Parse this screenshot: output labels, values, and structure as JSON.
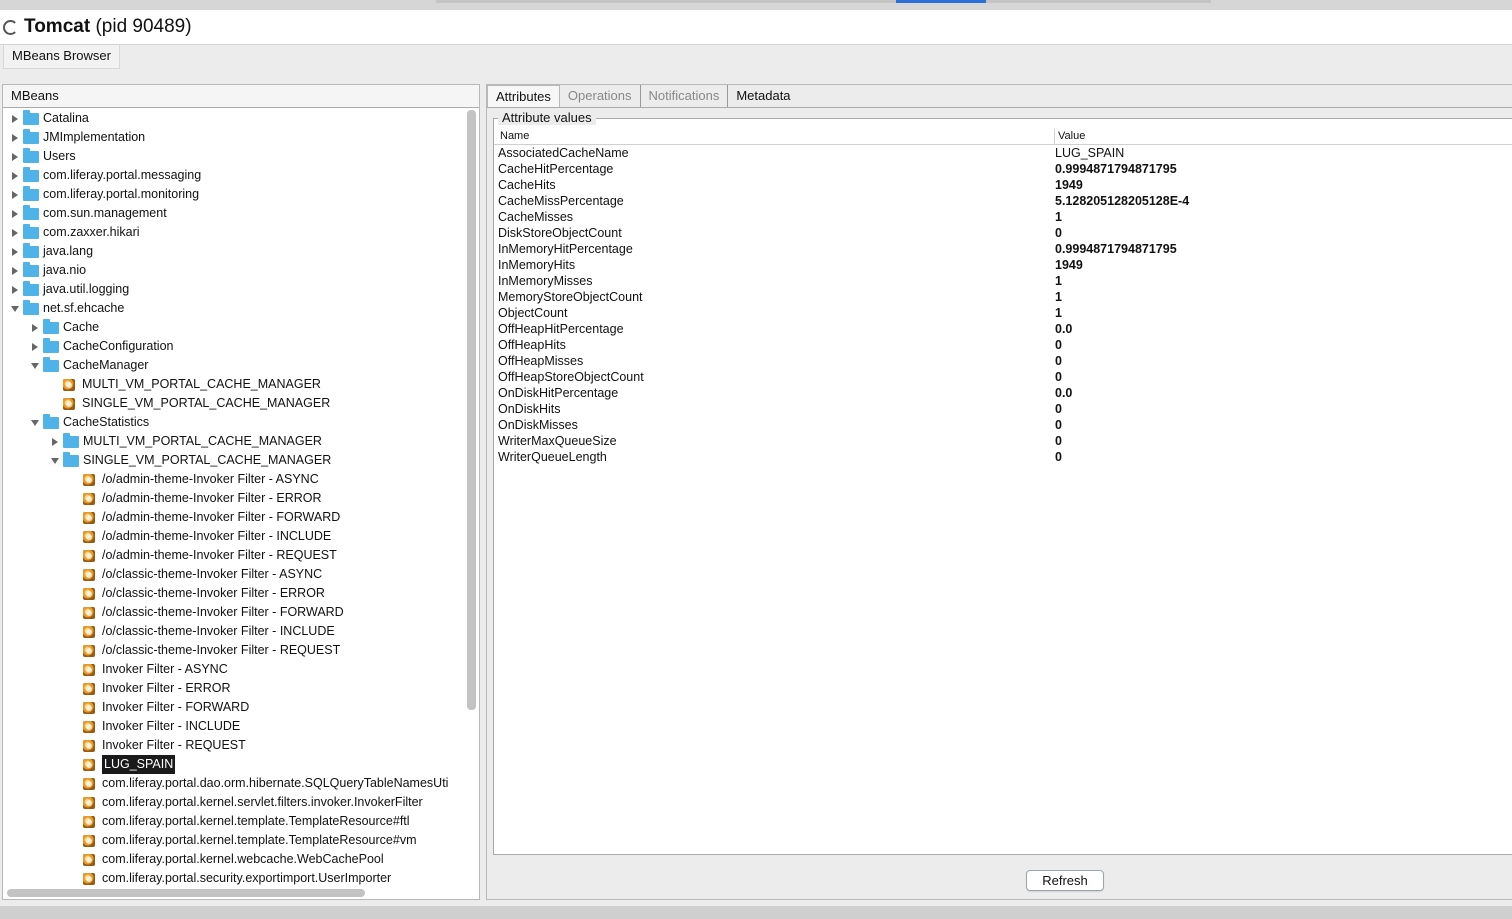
{
  "window": {
    "title_bold": "Tomcat",
    "title_rest": " (pid 90489)"
  },
  "subtab": "MBeans Browser",
  "left_panel": {
    "header": "MBeans"
  },
  "tree": [
    {
      "label": "Catalina",
      "type": "folder",
      "state": "collapsed",
      "depth": 0
    },
    {
      "label": "JMImplementation",
      "type": "folder",
      "state": "collapsed",
      "depth": 0
    },
    {
      "label": "Users",
      "type": "folder",
      "state": "collapsed",
      "depth": 0
    },
    {
      "label": "com.liferay.portal.messaging",
      "type": "folder",
      "state": "collapsed",
      "depth": 0
    },
    {
      "label": "com.liferay.portal.monitoring",
      "type": "folder",
      "state": "collapsed",
      "depth": 0
    },
    {
      "label": "com.sun.management",
      "type": "folder",
      "state": "collapsed",
      "depth": 0
    },
    {
      "label": "com.zaxxer.hikari",
      "type": "folder",
      "state": "collapsed",
      "depth": 0
    },
    {
      "label": "java.lang",
      "type": "folder",
      "state": "collapsed",
      "depth": 0
    },
    {
      "label": "java.nio",
      "type": "folder",
      "state": "collapsed",
      "depth": 0
    },
    {
      "label": "java.util.logging",
      "type": "folder",
      "state": "collapsed",
      "depth": 0
    },
    {
      "label": "net.sf.ehcache",
      "type": "folder",
      "state": "expanded",
      "depth": 0
    },
    {
      "label": "Cache",
      "type": "folder",
      "state": "collapsed",
      "depth": 1
    },
    {
      "label": "CacheConfiguration",
      "type": "folder",
      "state": "collapsed",
      "depth": 1
    },
    {
      "label": "CacheManager",
      "type": "folder",
      "state": "expanded",
      "depth": 1
    },
    {
      "label": "MULTI_VM_PORTAL_CACHE_MANAGER",
      "type": "bean",
      "state": "none",
      "depth": 2
    },
    {
      "label": "SINGLE_VM_PORTAL_CACHE_MANAGER",
      "type": "bean",
      "state": "none",
      "depth": 2
    },
    {
      "label": "CacheStatistics",
      "type": "folder",
      "state": "expanded",
      "depth": 1
    },
    {
      "label": "MULTI_VM_PORTAL_CACHE_MANAGER",
      "type": "folder",
      "state": "collapsed",
      "depth": 2
    },
    {
      "label": "SINGLE_VM_PORTAL_CACHE_MANAGER",
      "type": "folder",
      "state": "expanded",
      "depth": 2
    },
    {
      "label": "/o/admin-theme-Invoker Filter - ASYNC",
      "type": "bean",
      "state": "none",
      "depth": 3
    },
    {
      "label": "/o/admin-theme-Invoker Filter - ERROR",
      "type": "bean",
      "state": "none",
      "depth": 3
    },
    {
      "label": "/o/admin-theme-Invoker Filter - FORWARD",
      "type": "bean",
      "state": "none",
      "depth": 3
    },
    {
      "label": "/o/admin-theme-Invoker Filter - INCLUDE",
      "type": "bean",
      "state": "none",
      "depth": 3
    },
    {
      "label": "/o/admin-theme-Invoker Filter - REQUEST",
      "type": "bean",
      "state": "none",
      "depth": 3
    },
    {
      "label": "/o/classic-theme-Invoker Filter - ASYNC",
      "type": "bean",
      "state": "none",
      "depth": 3
    },
    {
      "label": "/o/classic-theme-Invoker Filter - ERROR",
      "type": "bean",
      "state": "none",
      "depth": 3
    },
    {
      "label": "/o/classic-theme-Invoker Filter - FORWARD",
      "type": "bean",
      "state": "none",
      "depth": 3
    },
    {
      "label": "/o/classic-theme-Invoker Filter - INCLUDE",
      "type": "bean",
      "state": "none",
      "depth": 3
    },
    {
      "label": "/o/classic-theme-Invoker Filter - REQUEST",
      "type": "bean",
      "state": "none",
      "depth": 3
    },
    {
      "label": "Invoker Filter - ASYNC",
      "type": "bean",
      "state": "none",
      "depth": 3
    },
    {
      "label": "Invoker Filter - ERROR",
      "type": "bean",
      "state": "none",
      "depth": 3
    },
    {
      "label": "Invoker Filter - FORWARD",
      "type": "bean",
      "state": "none",
      "depth": 3
    },
    {
      "label": "Invoker Filter - INCLUDE",
      "type": "bean",
      "state": "none",
      "depth": 3
    },
    {
      "label": "Invoker Filter - REQUEST",
      "type": "bean",
      "state": "none",
      "depth": 3
    },
    {
      "label": "LUG_SPAIN",
      "type": "bean",
      "state": "none",
      "depth": 3,
      "selected": true
    },
    {
      "label": "com.liferay.portal.dao.orm.hibernate.SQLQueryTableNamesUti",
      "type": "bean",
      "state": "none",
      "depth": 3
    },
    {
      "label": "com.liferay.portal.kernel.servlet.filters.invoker.InvokerFilter",
      "type": "bean",
      "state": "none",
      "depth": 3
    },
    {
      "label": "com.liferay.portal.kernel.template.TemplateResource#ftl",
      "type": "bean",
      "state": "none",
      "depth": 3
    },
    {
      "label": "com.liferay.portal.kernel.template.TemplateResource#vm",
      "type": "bean",
      "state": "none",
      "depth": 3
    },
    {
      "label": "com.liferay.portal.kernel.webcache.WebCachePool",
      "type": "bean",
      "state": "none",
      "depth": 3
    },
    {
      "label": "com.liferay.portal.security.exportimport.UserImporter",
      "type": "bean",
      "state": "none",
      "depth": 3
    }
  ],
  "tabs": [
    {
      "label": "Attributes",
      "style": "active"
    },
    {
      "label": "Operations",
      "style": "disabled"
    },
    {
      "label": "Notifications",
      "style": "disabled"
    },
    {
      "label": "Metadata",
      "style": "plain"
    }
  ],
  "attributes": {
    "title": "Attribute values",
    "col_name": "Name",
    "col_value": "Value",
    "rows": [
      {
        "name": "AssociatedCacheName",
        "value": "LUG_SPAIN",
        "bold": false
      },
      {
        "name": "CacheHitPercentage",
        "value": "0.9994871794871795",
        "bold": true
      },
      {
        "name": "CacheHits",
        "value": "1949",
        "bold": true
      },
      {
        "name": "CacheMissPercentage",
        "value": "5.128205128205128E-4",
        "bold": true
      },
      {
        "name": "CacheMisses",
        "value": "1",
        "bold": true
      },
      {
        "name": "DiskStoreObjectCount",
        "value": "0",
        "bold": true
      },
      {
        "name": "InMemoryHitPercentage",
        "value": "0.9994871794871795",
        "bold": true
      },
      {
        "name": "InMemoryHits",
        "value": "1949",
        "bold": true
      },
      {
        "name": "InMemoryMisses",
        "value": "1",
        "bold": true
      },
      {
        "name": "MemoryStoreObjectCount",
        "value": "1",
        "bold": true
      },
      {
        "name": "ObjectCount",
        "value": "1",
        "bold": true
      },
      {
        "name": "OffHeapHitPercentage",
        "value": "0.0",
        "bold": true
      },
      {
        "name": "OffHeapHits",
        "value": "0",
        "bold": true
      },
      {
        "name": "OffHeapMisses",
        "value": "0",
        "bold": true
      },
      {
        "name": "OffHeapStoreObjectCount",
        "value": "0",
        "bold": true
      },
      {
        "name": "OnDiskHitPercentage",
        "value": "0.0",
        "bold": true
      },
      {
        "name": "OnDiskHits",
        "value": "0",
        "bold": true
      },
      {
        "name": "OnDiskMisses",
        "value": "0",
        "bold": true
      },
      {
        "name": "WriterMaxQueueSize",
        "value": "0",
        "bold": true
      },
      {
        "name": "WriterQueueLength",
        "value": "0",
        "bold": true
      }
    ]
  },
  "refresh_label": "Refresh"
}
